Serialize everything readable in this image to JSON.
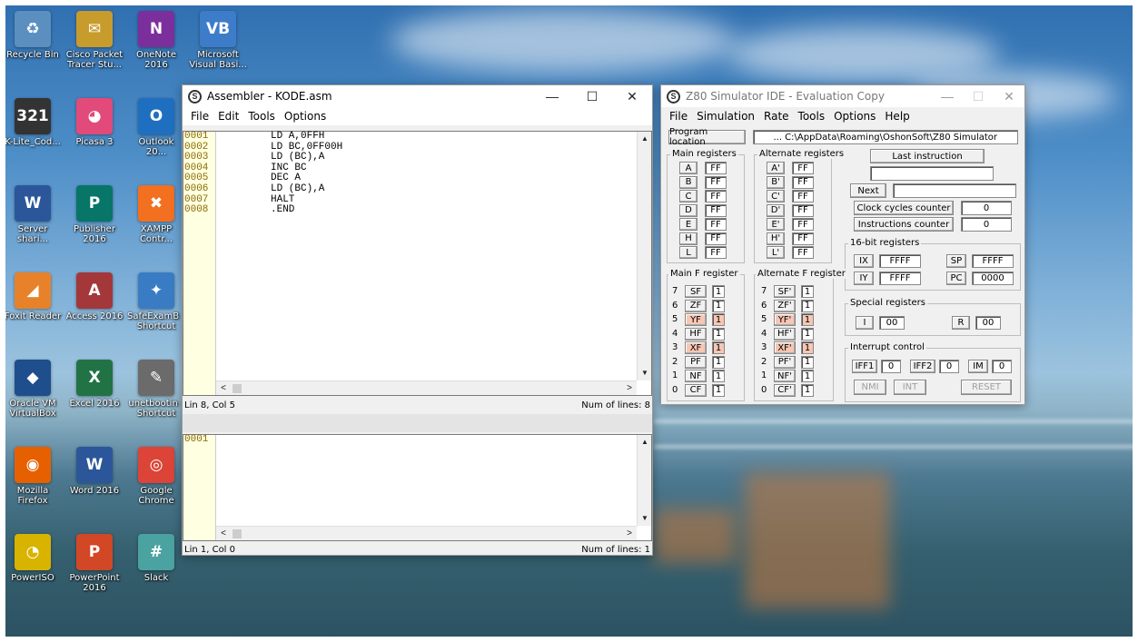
{
  "desktop": {
    "icons": [
      {
        "label": "Recycle Bin",
        "glyph": "♻",
        "color": "#5a8fc0"
      },
      {
        "label": "Cisco Packet Tracer Stu...",
        "glyph": "✉",
        "color": "#c79b2c"
      },
      {
        "label": "OneNote 2016",
        "glyph": "N",
        "color": "#7b2f9c"
      },
      {
        "label": "Microsoft Visual Basi...",
        "glyph": "VB",
        "color": "#3d7cc9"
      },
      {
        "label": "K-Lite_Cod...",
        "glyph": "321",
        "color": "#333333"
      },
      {
        "label": "Picasa 3",
        "glyph": "◕",
        "color": "#e24a7a"
      },
      {
        "label": "Outlook 20...",
        "glyph": "O",
        "color": "#1f6fc0"
      },
      {
        "label": "Server shari...",
        "glyph": "W",
        "color": "#2b579a"
      },
      {
        "label": "Publisher 2016",
        "glyph": "P",
        "color": "#077568"
      },
      {
        "label": "XAMPP Contr...",
        "glyph": "✖",
        "color": "#f2701f"
      },
      {
        "label": "Foxit Reader",
        "glyph": "◢",
        "color": "#e8822a"
      },
      {
        "label": "Access 2016",
        "glyph": "A",
        "color": "#a4373a"
      },
      {
        "label": "SafeExamB - Shortcut",
        "glyph": "✦",
        "color": "#3a7cc4"
      },
      {
        "label": "Oracle VM VirtualBox",
        "glyph": "◆",
        "color": "#1f4e8c"
      },
      {
        "label": "Excel 2016",
        "glyph": "X",
        "color": "#217346"
      },
      {
        "label": "unetbootin - Shortcut",
        "glyph": "✎",
        "color": "#6b6b6b"
      },
      {
        "label": "Mozilla Firefox",
        "glyph": "◉",
        "color": "#e66000"
      },
      {
        "label": "Word 2016",
        "glyph": "W",
        "color": "#2b579a"
      },
      {
        "label": "Google Chrome",
        "glyph": "◎",
        "color": "#db4437"
      },
      {
        "label": "PowerISO",
        "glyph": "◔",
        "color": "#d8b400"
      },
      {
        "label": "PowerPoint 2016",
        "glyph": "P",
        "color": "#d24726"
      },
      {
        "label": "Slack",
        "glyph": "#",
        "color": "#4aa3a0"
      }
    ]
  },
  "assembler": {
    "title": "Assembler - KODE.asm",
    "menu": [
      "File",
      "Edit",
      "Tools",
      "Options"
    ],
    "controls": {
      "minimize": "—",
      "maximize": "☐",
      "close": "✕"
    },
    "editor1": {
      "line_numbers": [
        "0001",
        "0002",
        "0003",
        "0004",
        "0005",
        "0006",
        "0007",
        "0008"
      ],
      "code_lines": [
        "LD A,0FFH",
        "LD BC,0FF00H",
        "LD (BC),A",
        "INC BC",
        "DEC A",
        "LD (BC),A",
        "HALT",
        ".END"
      ],
      "status_left": "Lin 8, Col 5",
      "status_right": "Num of lines: 8"
    },
    "editor2": {
      "line_numbers": [
        "0001"
      ],
      "status_left": "Lin 1, Col 0",
      "status_right": "Num of lines: 1"
    }
  },
  "z80": {
    "title": "Z80 Simulator IDE - Evaluation Copy",
    "menu": [
      "File",
      "Simulation",
      "Rate",
      "Tools",
      "Options",
      "Help"
    ],
    "controls": {
      "minimize": "—",
      "maximize": "☐",
      "close": "✕"
    },
    "program_location_label": "Program location",
    "program_location_value": "... C:\\AppData\\Roaming\\OshonSoft\\Z80 Simulator",
    "main_registers_title": "Main registers",
    "main_registers": [
      {
        "name": "A",
        "value": "FF"
      },
      {
        "name": "B",
        "value": "FF"
      },
      {
        "name": "C",
        "value": "FF"
      },
      {
        "name": "D",
        "value": "FF"
      },
      {
        "name": "E",
        "value": "FF"
      },
      {
        "name": "H",
        "value": "FF"
      },
      {
        "name": "L",
        "value": "FF"
      }
    ],
    "alt_registers_title": "Alternate registers",
    "alt_registers": [
      {
        "name": "A'",
        "value": "FF"
      },
      {
        "name": "B'",
        "value": "FF"
      },
      {
        "name": "C'",
        "value": "FF"
      },
      {
        "name": "D'",
        "value": "FF"
      },
      {
        "name": "E'",
        "value": "FF"
      },
      {
        "name": "H'",
        "value": "FF"
      },
      {
        "name": "L'",
        "value": "FF"
      }
    ],
    "last_instruction_label": "Last instruction",
    "last_instruction_value": "",
    "next_label": "Next",
    "next_value": "",
    "clock_cycles_label": "Clock cycles counter",
    "clock_cycles_value": "0",
    "instructions_label": "Instructions counter",
    "instructions_value": "0",
    "reg16_title": "16-bit registers",
    "reg16": {
      "IX": "FFFF",
      "SP": "FFFF",
      "IY": "FFFF",
      "PC": "0000"
    },
    "reg16_names": {
      "ix": "IX",
      "sp": "SP",
      "iy": "IY",
      "pc": "PC"
    },
    "main_f_title": "Main F register",
    "main_f": [
      {
        "bit": "7",
        "name": "SF",
        "value": "1",
        "pink": false
      },
      {
        "bit": "6",
        "name": "ZF",
        "value": "1",
        "pink": false
      },
      {
        "bit": "5",
        "name": "YF",
        "value": "1",
        "pink": true
      },
      {
        "bit": "4",
        "name": "HF",
        "value": "1",
        "pink": false
      },
      {
        "bit": "3",
        "name": "XF",
        "value": "1",
        "pink": true
      },
      {
        "bit": "2",
        "name": "PF",
        "value": "1",
        "pink": false
      },
      {
        "bit": "1",
        "name": "NF",
        "value": "1",
        "pink": false
      },
      {
        "bit": "0",
        "name": "CF",
        "value": "1",
        "pink": false
      }
    ],
    "alt_f_title": "Alternate F register",
    "alt_f": [
      {
        "bit": "7",
        "name": "SF'",
        "value": "1",
        "pink": false
      },
      {
        "bit": "6",
        "name": "ZF'",
        "value": "1",
        "pink": false
      },
      {
        "bit": "5",
        "name": "YF'",
        "value": "1",
        "pink": true
      },
      {
        "bit": "4",
        "name": "HF'",
        "value": "1",
        "pink": false
      },
      {
        "bit": "3",
        "name": "XF'",
        "value": "1",
        "pink": true
      },
      {
        "bit": "2",
        "name": "PF'",
        "value": "1",
        "pink": false
      },
      {
        "bit": "1",
        "name": "NF'",
        "value": "1",
        "pink": false
      },
      {
        "bit": "0",
        "name": "CF'",
        "value": "1",
        "pink": false
      }
    ],
    "special_title": "Special registers",
    "special": {
      "I_name": "I",
      "I": "00",
      "R_name": "R",
      "R": "00"
    },
    "interrupt_title": "Interrupt control",
    "interrupt": {
      "IFF1_name": "IFF1",
      "IFF1": "0",
      "IFF2_name": "IFF2",
      "IFF2": "0",
      "IM_name": "IM",
      "IM": "0"
    },
    "buttons": {
      "nmi": "NMI",
      "int": "INT",
      "reset": "RESET"
    }
  }
}
